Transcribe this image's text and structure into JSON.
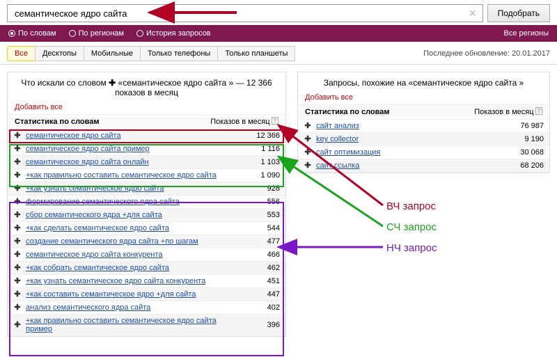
{
  "search": {
    "value": "семантическое ядро сайта",
    "button": "Подобрать"
  },
  "filters": {
    "by_words": "По словам",
    "by_regions": "По регионам",
    "history": "История запросов",
    "all_regions": "Все регионы"
  },
  "device_tabs": [
    "Все",
    "Десктопы",
    "Мобильные",
    "Только телефоны",
    "Только планшеты"
  ],
  "last_update_label": "Последнее обновление:",
  "last_update_value": "20.01.2017",
  "left": {
    "title_prefix": "Что искали со словом ",
    "title_kw": "«семантическое ядро сайта »",
    "title_suffix": " — 12 366 показов в месяц",
    "add_all": "Добавить все",
    "col_kw": "Статистика по словам",
    "col_cnt": "Показов в месяц",
    "rows": [
      {
        "kw": "семантическое ядро сайта",
        "cnt": "12 366"
      },
      {
        "kw": "семантическое ядро сайта пример",
        "cnt": "1 116"
      },
      {
        "kw": "семантическое ядро сайта онлайн",
        "cnt": "1 103"
      },
      {
        "kw": "+как правильно составить семантическое ядро сайта",
        "cnt": "1 090"
      },
      {
        "kw": "+как узнать семантическое ядро сайта",
        "cnt": "928"
      },
      {
        "kw": "формирование семантического ядра сайта",
        "cnt": "556"
      },
      {
        "kw": "сбор семантического ядра +для сайта",
        "cnt": "553"
      },
      {
        "kw": "+как сделать семантическое ядро сайта",
        "cnt": "544"
      },
      {
        "kw": "создание семантического ядра сайта +по шагам",
        "cnt": "477"
      },
      {
        "kw": "семантическое ядро сайта конкурента",
        "cnt": "466"
      },
      {
        "kw": "+как собрать семантическое ядро сайта",
        "cnt": "462"
      },
      {
        "kw": "+как узнать семантическое ядро сайта конкурента",
        "cnt": "451"
      },
      {
        "kw": "+как составить семантическое ядро +для сайта",
        "cnt": "447"
      },
      {
        "kw": "анализ семантического ядра сайта",
        "cnt": "402"
      },
      {
        "kw": "+как правильно составить семантическое ядро сайта пример",
        "cnt": "396"
      }
    ]
  },
  "right": {
    "title": "Запросы, похожие на «семантическое ядро сайта »",
    "add_all": "Добавить все",
    "col_kw": "Статистика по словам",
    "col_cnt": "Показов в месяц",
    "rows": [
      {
        "kw": "сайт анализ",
        "cnt": "76 987"
      },
      {
        "kw": "key collector",
        "cnt": "9 190"
      },
      {
        "kw": "сайт оптимизация",
        "cnt": "30 068"
      },
      {
        "kw": "сайт ссылка",
        "cnt": "68 206"
      }
    ]
  },
  "annotations": {
    "hf": "ВЧ запрос",
    "mf": "СЧ запрос",
    "lf": "НЧ запрос"
  }
}
